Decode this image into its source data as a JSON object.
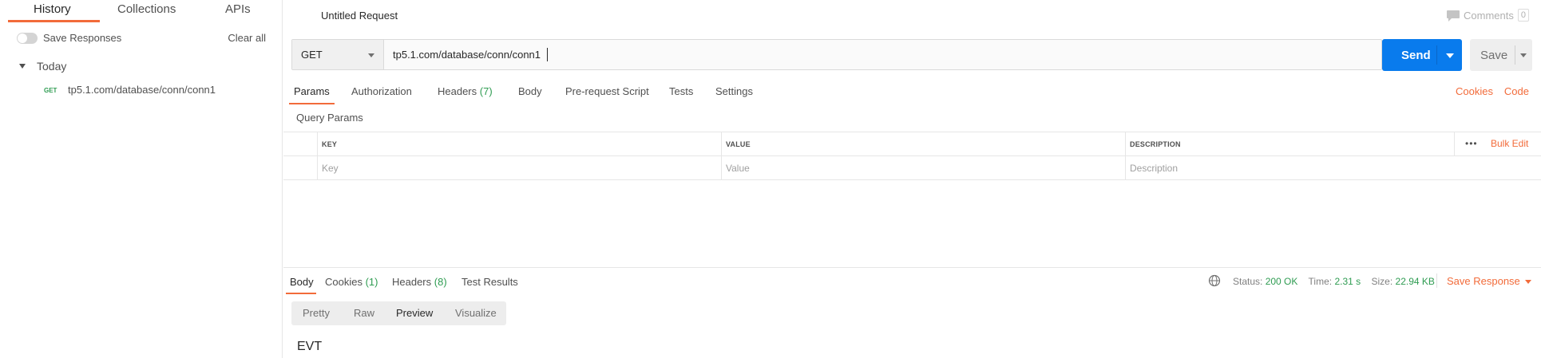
{
  "sidebar": {
    "tabs": [
      {
        "label": "History",
        "active": true
      },
      {
        "label": "Collections",
        "active": false
      },
      {
        "label": "APIs",
        "active": false
      }
    ],
    "save_responses_label": "Save Responses",
    "save_responses_on": false,
    "clear_all_label": "Clear all",
    "group_label": "Today",
    "history": [
      {
        "method": "GET",
        "url": "tp5.1.com/database/conn/conn1"
      }
    ]
  },
  "request": {
    "title": "Untitled Request",
    "comments_label": "Comments",
    "comments_count": "0",
    "method": "GET",
    "url": "tp5.1.com/database/conn/conn1",
    "send_label": "Send",
    "save_label": "Save",
    "tabs": [
      {
        "label": "Params",
        "count": "",
        "active": true
      },
      {
        "label": "Authorization",
        "count": ""
      },
      {
        "label": "Headers",
        "count": "(7)"
      },
      {
        "label": "Body",
        "count": ""
      },
      {
        "label": "Pre-request Script",
        "count": ""
      },
      {
        "label": "Tests",
        "count": ""
      },
      {
        "label": "Settings",
        "count": ""
      }
    ],
    "cookies_link": "Cookies",
    "code_link": "Code",
    "query_params_title": "Query Params",
    "table": {
      "headers": [
        "KEY",
        "VALUE",
        "DESCRIPTION"
      ],
      "placeholders": [
        "Key",
        "Value",
        "Description"
      ],
      "more_label": "•••",
      "bulk_edit_label": "Bulk Edit"
    }
  },
  "response": {
    "tabs": [
      {
        "label": "Body",
        "count": "",
        "active": true
      },
      {
        "label": "Cookies",
        "count": "(1)"
      },
      {
        "label": "Headers",
        "count": "(8)"
      },
      {
        "label": "Test Results",
        "count": ""
      }
    ],
    "status_label": "Status:",
    "status_value": "200 OK",
    "time_label": "Time:",
    "time_value": "2.31 s",
    "size_label": "Size:",
    "size_value": "22.94 KB",
    "save_response_label": "Save Response",
    "view_modes": [
      {
        "label": "Pretty"
      },
      {
        "label": "Raw"
      },
      {
        "label": "Preview",
        "active": true
      },
      {
        "label": "Visualize"
      }
    ],
    "preview_text": "EVT"
  },
  "colors": {
    "accent": "#f26b3a",
    "send_blue": "#097bed",
    "success_green": "#2f9c52"
  },
  "icons": [
    "comment-icon",
    "globe-icon",
    "chevron-down-icon"
  ]
}
